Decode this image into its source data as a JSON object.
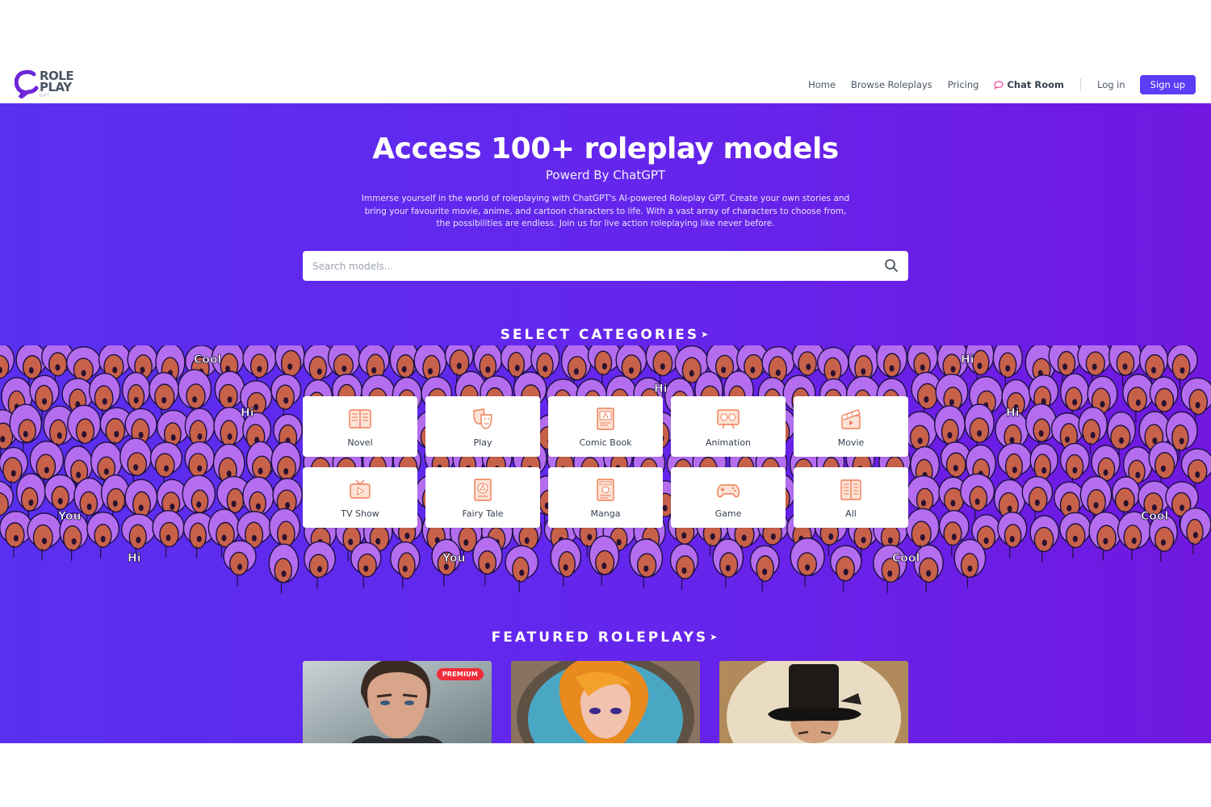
{
  "brand": {
    "name_line1": "ROLE",
    "name_line2": "PLAY",
    "sub": "GPT"
  },
  "nav": {
    "items": [
      "Home",
      "Browse Roleplays",
      "Pricing"
    ],
    "chat_room": "Chat Room",
    "login": "Log in",
    "signup": "Sign up"
  },
  "hero": {
    "title": "Access 100+ roleplay models",
    "subtitle": "Powerd By ChatGPT",
    "description": "Immerse yourself in the world of roleplaying with ChatGPT's AI-powered Roleplay GPT. Create your own stories and bring your favourite movie, anime, and cartoon characters to life. With a vast array of characters to choose from, the possibilities are endless. Join us for live action roleplaying like never before."
  },
  "search": {
    "placeholder": "Search models..."
  },
  "categories": {
    "title": "SELECT CATEGORIES",
    "arrow": "➤",
    "items": [
      {
        "label": "Novel",
        "icon": "book-icon"
      },
      {
        "label": "Play",
        "icon": "theater-masks-icon"
      },
      {
        "label": "Comic Book",
        "icon": "comic-book-icon"
      },
      {
        "label": "Animation",
        "icon": "animation-screen-icon"
      },
      {
        "label": "Movie",
        "icon": "clapperboard-icon"
      },
      {
        "label": "TV Show",
        "icon": "tv-icon"
      },
      {
        "label": "Fairy Tale",
        "icon": "fairy-tale-book-icon"
      },
      {
        "label": "Manga",
        "icon": "manga-book-icon"
      },
      {
        "label": "Game",
        "icon": "gamepad-icon"
      },
      {
        "label": "All",
        "icon": "open-books-icon"
      }
    ],
    "crowd_words": [
      "Cool",
      "Hi",
      "Hi",
      "You",
      "Hi",
      "Cool",
      "You",
      "Hi",
      "Cool",
      "Hi"
    ]
  },
  "featured": {
    "title": "FEATURED ROLEPLAYS",
    "arrow": "➤",
    "badge": "PREMIUM"
  },
  "colors": {
    "accent": "#5b3df5",
    "hero_gradient_start": "#5a2ff0",
    "hero_gradient_end": "#7118e0",
    "icon_orange": "#f0845c",
    "premium_red": "#ef2d3a",
    "crowd_hair": "#b56df0",
    "crowd_face": "#c8614a"
  }
}
